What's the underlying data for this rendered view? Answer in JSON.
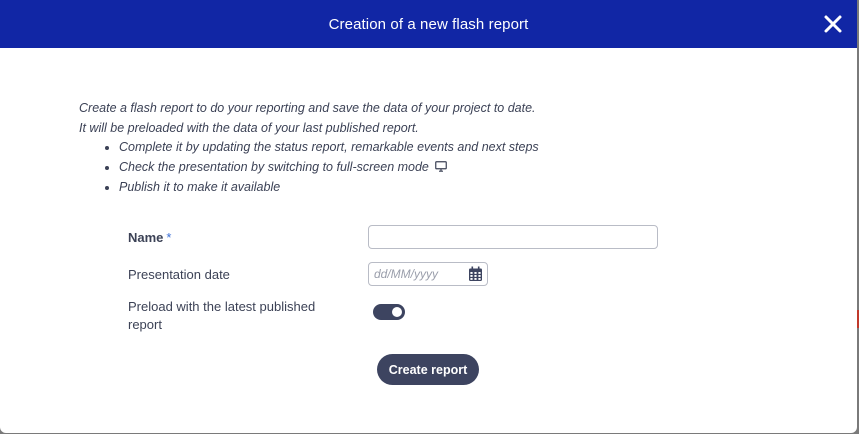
{
  "dialog": {
    "title": "Creation of a new flash report",
    "close_icon": "close-icon"
  },
  "intro": {
    "line1": "Create a flash report to do your reporting and save the data of your project to date.",
    "line2": "It will be preloaded with the data of your last published report.",
    "bullets": [
      "Complete it by updating the status report, remarkable events and next steps",
      "Check the presentation by switching to full-screen mode",
      "Publish it to make it available"
    ],
    "fullscreen_icon": "monitor-icon"
  },
  "form": {
    "name_label": "Name",
    "name_required_mark": "*",
    "name_value": "",
    "date_label": "Presentation date",
    "date_placeholder": "dd/MM/yyyy",
    "date_icon": "calendar-icon",
    "preload_label": "Preload with the latest published report",
    "preload_enabled": true
  },
  "actions": {
    "create_label": "Create report"
  },
  "colors": {
    "header": "#1126a5",
    "primary_button": "#3d4460",
    "text": "#3c4256",
    "required": "#3b6fd6"
  }
}
